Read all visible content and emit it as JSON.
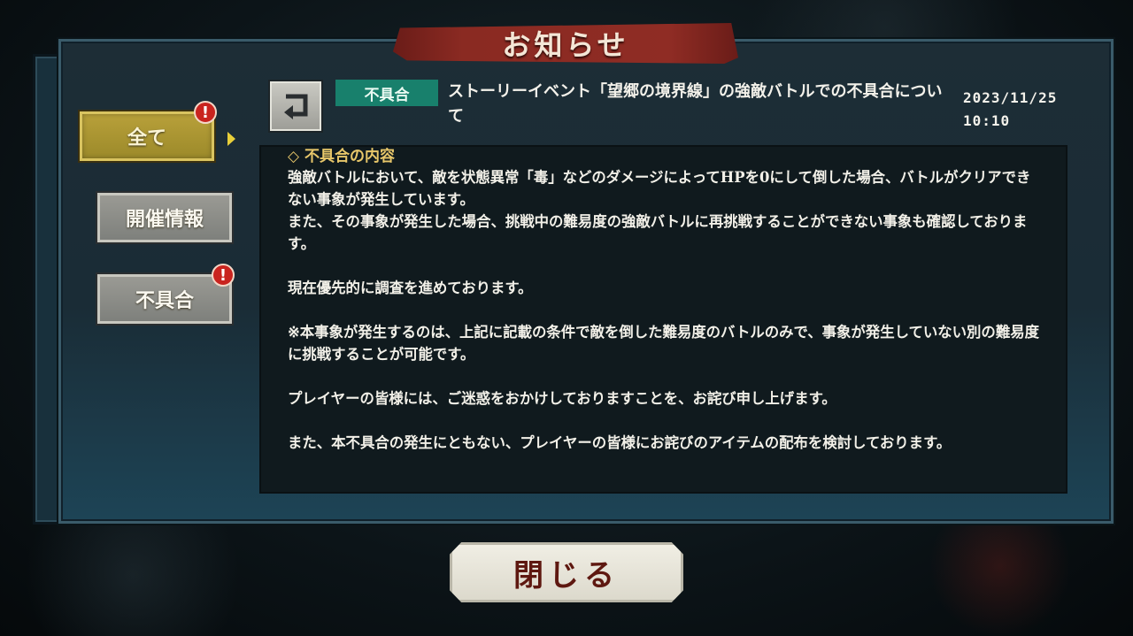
{
  "dialog": {
    "title": "お知らせ"
  },
  "sidebar": {
    "tabs": [
      {
        "label": "全て",
        "selected": true,
        "alert": "!"
      },
      {
        "label": "開催情報",
        "selected": false
      },
      {
        "label": "不具合",
        "selected": false,
        "alert": "!"
      }
    ]
  },
  "article": {
    "category": "不具合",
    "title": "ストーリーイベント「望郷の境界線」の強敵バトルでの不具合について",
    "date": "2023/11/25",
    "time": "10:10",
    "section_heading": "◇ 不具合の内容",
    "body": "強敵バトルにおいて、敵を状態異常「毒」などのダメージによってHPを0にして倒した場合、バトルがクリアできない事象が発生しています。\nまた、その事象が発生した場合、挑戦中の難易度の強敵バトルに再挑戦することができない事象も確認しております。\n\n現在優先的に調査を進めております。\n\n※本事象が発生するのは、上記に記載の条件で敵を倒した難易度のバトルのみで、事象が発生していない別の難易度に挑戦することが可能です。\n\nプレイヤーの皆様には、ご迷惑をおかけしておりますことを、お詫び申し上げます。\n\nまた、本不具合の発生にともない、プレイヤーの皆様にお詫びのアイテムの配布を検討しております。"
  },
  "footer": {
    "close_label": "閉じる"
  },
  "icons": {
    "back": "back-arrow-icon",
    "alert": "exclamation-icon",
    "selected_indicator": "triangle-right-icon"
  },
  "colors": {
    "selected_tab": "#b8a03a",
    "category_badge": "#18806c",
    "alert_badge": "#c9241f",
    "title_banner": "#8a2a22",
    "close_label": "#5e1810"
  }
}
